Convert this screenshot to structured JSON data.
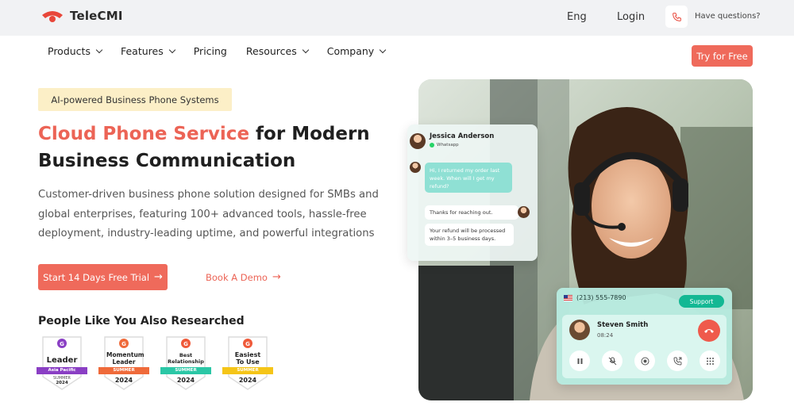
{
  "brand": {
    "name": "TeleCMI",
    "accent": "#ef6a5b"
  },
  "topbar": {
    "language": "Eng",
    "login": "Login",
    "help": "Have questions?"
  },
  "nav": {
    "items": [
      {
        "label": "Products",
        "dropdown": true
      },
      {
        "label": "Features",
        "dropdown": true
      },
      {
        "label": "Pricing",
        "dropdown": false
      },
      {
        "label": "Resources",
        "dropdown": true
      },
      {
        "label": "Company",
        "dropdown": true
      }
    ],
    "cta": "Try for Free"
  },
  "hero": {
    "pill": "AI-powered Business Phone Systems",
    "headline_accent": "Cloud Phone Service",
    "headline_rest_line1": " for Modern",
    "headline_line2": "Business Communication",
    "description": "Customer-driven business phone solution designed for SMBs and global enterprises, featuring 100+ advanced tools, hassle-free deployment, industry-leading uptime, and powerful integrations",
    "primary_cta": "Start 14 Days Free Trial",
    "secondary_cta": "Book A Demo"
  },
  "research": {
    "title": "People Like You Also Researched",
    "badges": [
      {
        "title": "Leader",
        "ribbon": "Asia Pacific",
        "season": "SUMMER",
        "year": "2024",
        "ribbon_color": "#8a3fc4"
      },
      {
        "title": "Momentum Leader",
        "ribbon": "SUMMER",
        "season": "",
        "year": "2024",
        "ribbon_color": "#ef6a3a"
      },
      {
        "title": "Best Relationship",
        "ribbon": "SUMMER",
        "season": "",
        "year": "2024",
        "ribbon_color": "#2bc7a6"
      },
      {
        "title": "Easiest To Use",
        "ribbon": "SUMMER",
        "season": "",
        "year": "2024",
        "ribbon_color": "#f5c518"
      }
    ]
  },
  "chat": {
    "name": "Jessica Anderson",
    "channel": "Whatsapp",
    "incoming": "Hi, I returned my order last week. When will I get my refund?",
    "reply1": "Thanks for reaching out.",
    "reply2": "Your refund will be processed within 3–5 business days."
  },
  "call": {
    "number": "(213) 555-7890",
    "tag": "Support",
    "caller": "Steven Smith",
    "duration": "08:24",
    "controls": [
      "pause-icon",
      "mute-icon",
      "record-icon",
      "transfer-icon",
      "keypad-icon"
    ]
  }
}
